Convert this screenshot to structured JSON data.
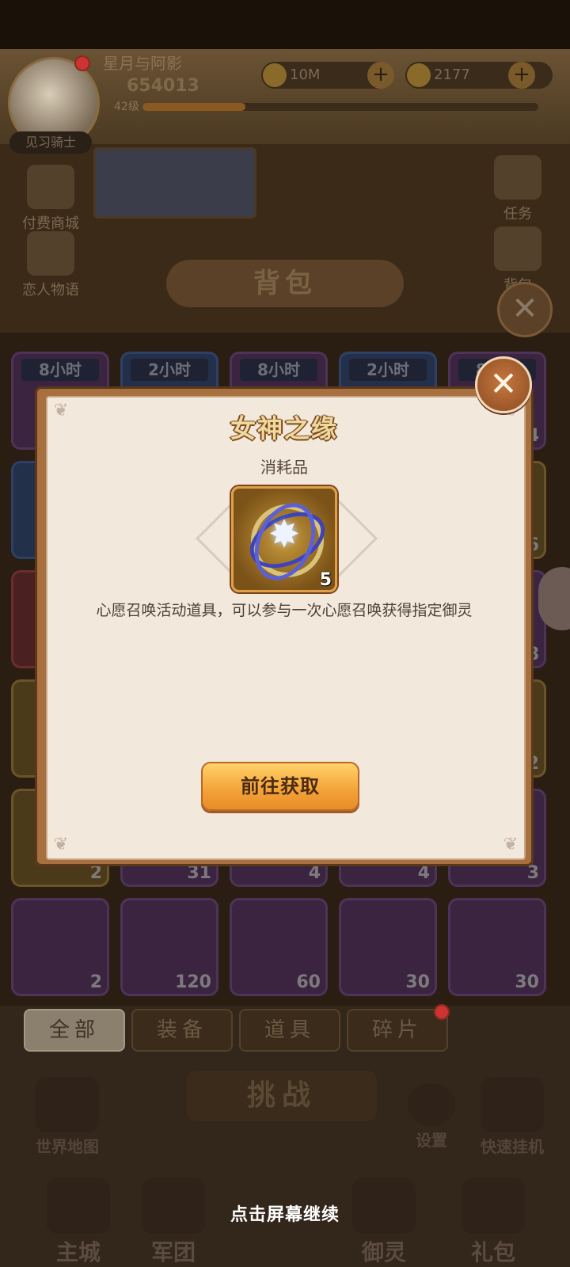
{
  "player": {
    "name": "星月与阿影",
    "power": "654013",
    "level": "42级",
    "title": "见习骑士"
  },
  "resources": {
    "gold": "10M",
    "gems": "2177"
  },
  "left_menu": [
    "付费商城",
    "恋人物语"
  ],
  "right_menu": [
    "任务",
    "背包"
  ],
  "panel_title": "背包",
  "grid": {
    "timers": [
      "8小时",
      "2小时",
      "8小时",
      "2小时",
      "8小时"
    ],
    "counts": {
      "row1_last": "4",
      "row2_last": "6",
      "row3_last": "8",
      "row4_last": "22",
      "row5": [
        "2",
        "31",
        "4",
        "4",
        "3"
      ],
      "row6": [
        "2",
        "120",
        "60",
        "30",
        "30"
      ]
    }
  },
  "tabs": [
    "全部",
    "装备",
    "道具",
    "碎片"
  ],
  "challenge_label": "挑战",
  "nav": {
    "world_map": "世界地图",
    "settings": "设置",
    "quick_idle": "快速挂机",
    "main_city": "主城",
    "legion": "军团",
    "spirit": "御灵",
    "gift": "礼包"
  },
  "dialog": {
    "title": "女神之缘",
    "category": "消耗品",
    "item_icon": "orbit-star-icon",
    "quantity": "5",
    "description": "心愿召唤活动道具，可以参与一次心愿召唤获得指定御灵",
    "button_label": "前往获取",
    "close_icon": "close-icon"
  },
  "continue_hint": "点击屏幕继续",
  "colors": {
    "dialog_frame": "#a8703e",
    "dialog_bg": "#f2e8dc",
    "button": "#f3a138",
    "title_text": "#efd9a0"
  }
}
